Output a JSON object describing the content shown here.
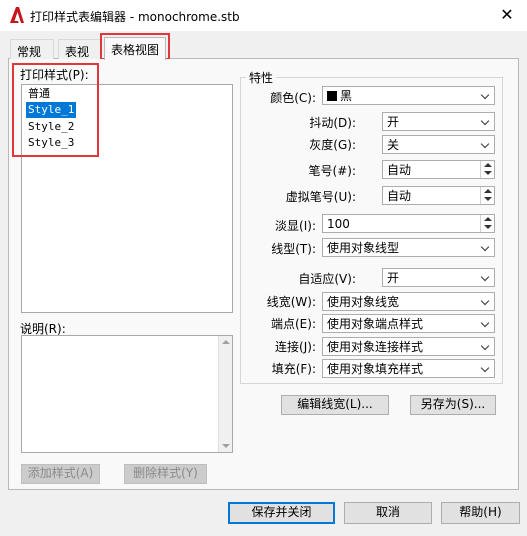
{
  "window": {
    "title": "打印样式表编辑器 - monochrome.stb",
    "close_glyph": "✕"
  },
  "tabs": [
    {
      "label": "常规"
    },
    {
      "label": "表视图"
    },
    {
      "label": "表格视图"
    }
  ],
  "styles_list": {
    "label": "打印样式(P):",
    "items": [
      "普通",
      "Style_1",
      "Style_2",
      "Style_3"
    ]
  },
  "description": {
    "label": "说明(R):"
  },
  "left_buttons": {
    "add": "添加样式(A)",
    "delete": "删除样式(Y)"
  },
  "properties": {
    "group_label": "特性",
    "color": {
      "label": "颜色(C):",
      "value": "黑"
    },
    "dither": {
      "label": "抖动(D):",
      "value": "开"
    },
    "grayscale": {
      "label": "灰度(G):",
      "value": "关"
    },
    "pen": {
      "label": "笔号(#):",
      "value": "自动"
    },
    "virtual_pen": {
      "label": "虚拟笔号(U):",
      "value": "自动"
    },
    "screening": {
      "label": "淡显(I):",
      "value": "100"
    },
    "linetype": {
      "label": "线型(T):",
      "value": "使用对象线型"
    },
    "adaptive": {
      "label": "自适应(V):",
      "value": "开"
    },
    "lineweight": {
      "label": "线宽(W):",
      "value": "使用对象线宽"
    },
    "endstyle": {
      "label": "端点(E):",
      "value": "使用对象端点样式"
    },
    "joinstyle": {
      "label": "连接(J):",
      "value": "使用对象连接样式"
    },
    "fillstyle": {
      "label": "填充(F):",
      "value": "使用对象填充样式"
    }
  },
  "right_buttons": {
    "edit_lineweights": "编辑线宽(L)...",
    "save_as": "另存为(S)..."
  },
  "footer_buttons": {
    "save_close": "保存并关闭",
    "cancel": "取消",
    "help": "帮助(H)"
  },
  "colors": {
    "accent": "#0078d7",
    "highlight_box": "#e0363c",
    "app_icon": "#c4161c"
  }
}
